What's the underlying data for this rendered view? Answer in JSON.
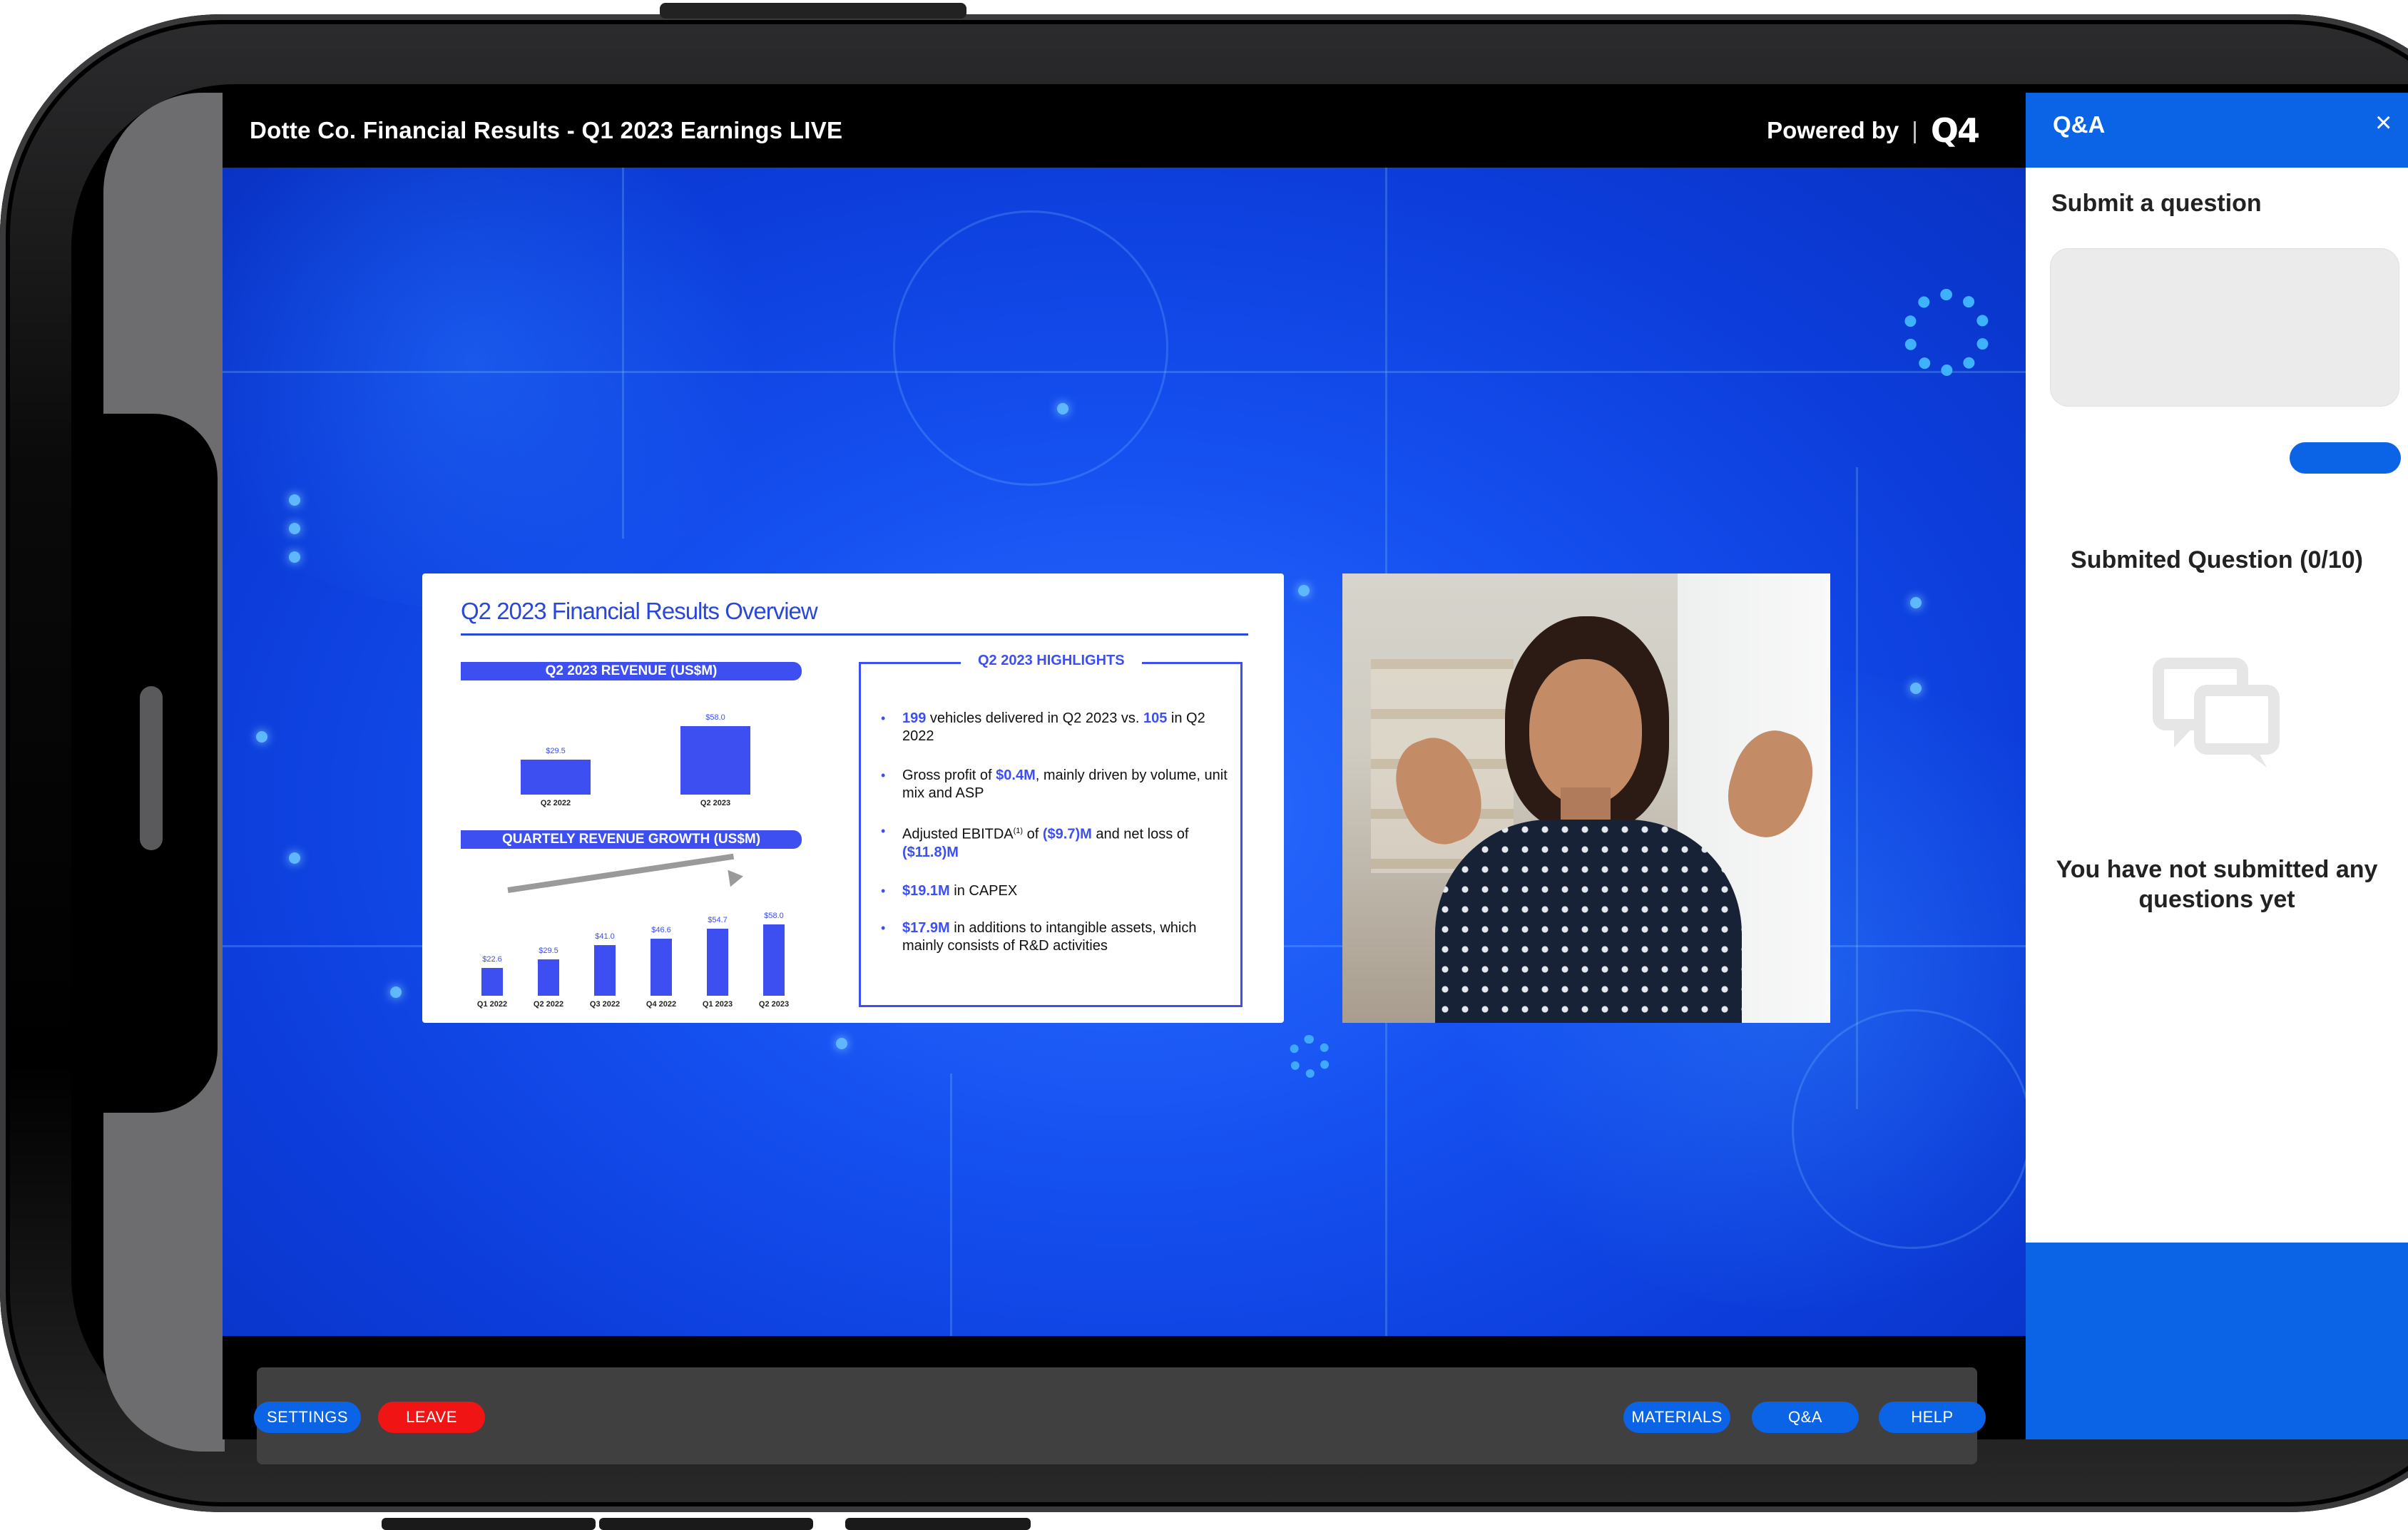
{
  "window": {
    "event_title": "Dotte Co. Financial Results - Q1 2023 Earnings LIVE",
    "powered_by": "Powered by",
    "separator": "|",
    "brand": "Q4"
  },
  "slide": {
    "title": "Q2 2023 Financial Results Overview",
    "revenue_chart": {
      "heading": "Q2 2023 REVENUE (US$M)",
      "categories": [
        "Q2 2022",
        "Q2 2023"
      ],
      "values": [
        29.5,
        58.0
      ],
      "value_labels": [
        "$29.5",
        "$58.0"
      ]
    },
    "growth_chart": {
      "heading": "QUARTELY REVENUE GROWTH (US$M)",
      "categories": [
        "Q1 2022",
        "Q2 2022",
        "Q3 2022",
        "Q4 2022",
        "Q1 2023",
        "Q2 2023"
      ],
      "values": [
        22.6,
        29.5,
        41.0,
        46.6,
        54.7,
        58.0
      ],
      "value_labels": [
        "$22.6",
        "$29.5",
        "$41.0",
        "$46.6",
        "$54.7",
        "$58.0"
      ]
    },
    "highlights": {
      "title": "Q2 2023 HIGHLIGHTS",
      "items": [
        {
          "em": "199",
          "text": " vehicles delivered in Q2 2023 vs. ",
          "em2": "105",
          "text2": " in Q2 2022"
        },
        {
          "text": "Gross profit of ",
          "em": "$0.4M",
          "text2": ", mainly driven by volume, unit mix and ASP"
        },
        {
          "text": "Adjusted EBITDA",
          "sup": "(1)",
          "text2": " of ",
          "em": "($9.7)M",
          "text3": " and net loss of ",
          "em2": "($11.8)M"
        },
        {
          "em": "$19.1M",
          "text": " in CAPEX"
        },
        {
          "em": "$17.9M",
          "text": " in additions to intangible assets, which mainly consists of R&D activities"
        }
      ]
    }
  },
  "controls": {
    "settings": "SETTINGS",
    "leave": "LEAVE",
    "materials": "MATERIALS",
    "qa": "Q&A",
    "help": "HELP"
  },
  "qa_panel": {
    "title": "Q&A",
    "close": "×",
    "submit_label": "Submit a question",
    "submitted_count": "Submited Question (0/10)",
    "empty_message": "You have not submitted any questions yet"
  },
  "colors": {
    "accent": "#0b63e5",
    "leave": "#f01414",
    "stage_blue": "#1550f0",
    "slide_blue": "#3d4ff0"
  }
}
